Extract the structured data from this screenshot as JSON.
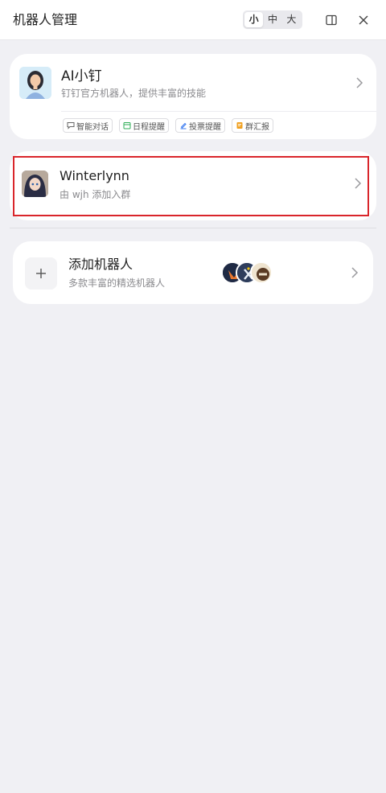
{
  "header": {
    "title": "机器人管理",
    "sizes": [
      "小",
      "中",
      "大"
    ],
    "active_size": "小"
  },
  "featured_bot": {
    "name": "AI小钉",
    "description": "钉钉官方机器人，提供丰富的技能",
    "tags": [
      {
        "label": "智能对话",
        "icon": "chat-icon",
        "color": "#666666"
      },
      {
        "label": "日程提醒",
        "icon": "calendar-icon",
        "color": "#2fae57"
      },
      {
        "label": "投票提醒",
        "icon": "vote-icon",
        "color": "#3b7bf0"
      },
      {
        "label": "群汇报",
        "icon": "report-icon",
        "color": "#f0a020"
      }
    ]
  },
  "bot": {
    "name": "Winterlynn",
    "description": "由 wjh 添加入群"
  },
  "add_bot": {
    "title": "添加机器人",
    "description": "多款丰富的精选机器人"
  },
  "colors": {
    "background": "#f0f0f4",
    "card": "#ffffff",
    "highlight": "#d9252b"
  }
}
